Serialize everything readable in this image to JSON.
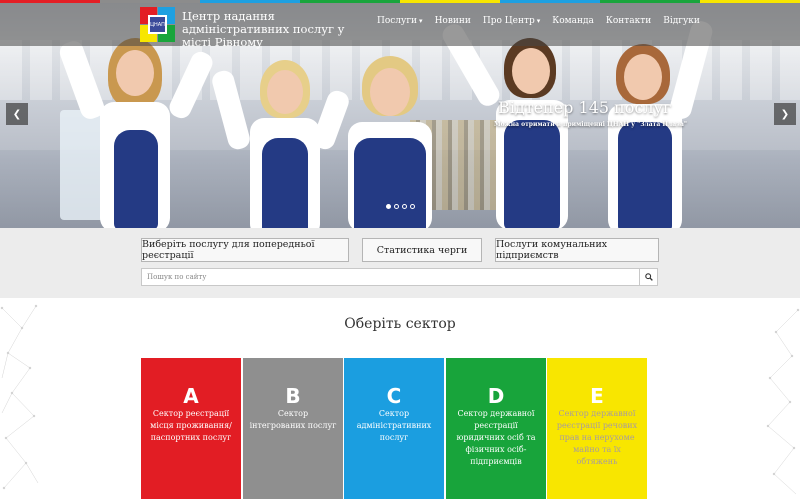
{
  "stripe_colors": [
    "#e31e24",
    "#8c8c8c",
    "#1ea0e1",
    "#19a53c",
    "#f7e600",
    "#1ea0e1",
    "#19a53c",
    "#f7e600"
  ],
  "header": {
    "logo_text": "ЦНАП",
    "site_title": "Центр надання адміністративних послуг у місті Рівному",
    "nav": [
      {
        "label": "Послуги",
        "dropdown": true
      },
      {
        "label": "Новини",
        "dropdown": false
      },
      {
        "label": "Про Центр",
        "dropdown": true
      },
      {
        "label": "Команда",
        "dropdown": false
      },
      {
        "label": "Контакти",
        "dropdown": false
      },
      {
        "label": "Відгуки",
        "dropdown": false
      }
    ]
  },
  "slider": {
    "title": "Відтепер 145 послуг",
    "subtitle": "Можна отримати в приміщенні ЦНАП у \"Злата Плаза\"",
    "prev_icon": "chevron-left-icon",
    "next_icon": "chevron-right-icon",
    "slide_count": 4,
    "active_slide": 1
  },
  "quick": {
    "btn_register": "Виберіть послугу для попередньої реєстрації",
    "btn_queue": "Статистика черги",
    "btn_utility": "Послуги комунальних підприємств",
    "search_placeholder": "Пошук по сайту",
    "search_icon": "search-icon"
  },
  "sectors": {
    "title": "Оберіть сектор",
    "items": [
      {
        "letter": "А",
        "label": "Сектор реєстрації місця проживання/ паспортних послуг",
        "color": "#e21d24"
      },
      {
        "letter": "В",
        "label": "Сектор інтегрованих послуг",
        "color": "#8f8f8f"
      },
      {
        "letter": "С",
        "label": "Сектор адміністративних послуг",
        "color": "#1b9ee0"
      },
      {
        "letter": "D",
        "label": "Сектор державної реєстрації юридичних осіб та фізичних осіб-підприємців",
        "color": "#18a43b"
      },
      {
        "letter": "Е",
        "label": "Сектор державної реєстрації речових прав на нерухоме майно та їх обтяжень",
        "color": "#f8e600"
      }
    ]
  }
}
